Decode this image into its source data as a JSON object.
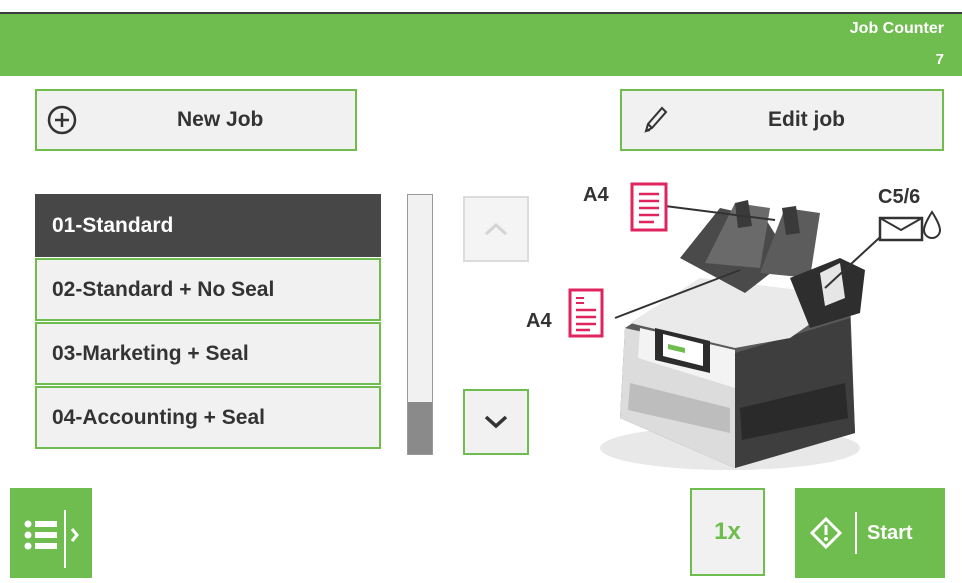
{
  "header": {
    "counter_label": "Job Counter",
    "counter_value": "7",
    "accent_color": "#6ebd4e"
  },
  "toolbar": {
    "new_job_label": "New Job",
    "new_job_icon": "plus-circle-icon",
    "edit_job_label": "Edit job",
    "edit_job_icon": "pencil-icon"
  },
  "jobs": {
    "items": [
      {
        "label": "01-Standard",
        "selected": true
      },
      {
        "label": "02-Standard + No Seal",
        "selected": false
      },
      {
        "label": "03-Marketing + Seal",
        "selected": false
      },
      {
        "label": "04-Accounting + Seal",
        "selected": false
      }
    ]
  },
  "machine": {
    "feeder_top_label": "A4",
    "feeder_mid_label": "A4",
    "envelope_label": "C5/6",
    "envelope_icon": "envelope-seal-icon"
  },
  "footer": {
    "menu_icon": "menu-expand-icon",
    "count_label": "1x",
    "start_label": "Start",
    "start_icon": "start-diamond-icon"
  }
}
